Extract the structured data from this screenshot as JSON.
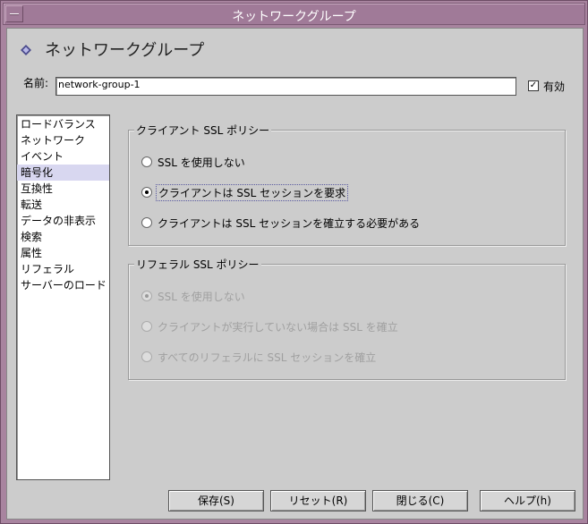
{
  "window": {
    "title": "ネットワークグループ"
  },
  "header": {
    "title": "ネットワークグループ"
  },
  "name_field": {
    "label": "名前:",
    "value": "network-group-1"
  },
  "enabled": {
    "label": "有効",
    "checked": true,
    "check_glyph": "✓"
  },
  "sidebar": {
    "items": [
      {
        "label": "ロードバランス"
      },
      {
        "label": "ネットワーク"
      },
      {
        "label": "イベント"
      },
      {
        "label": "暗号化",
        "selected": true
      },
      {
        "label": "互換性"
      },
      {
        "label": "転送"
      },
      {
        "label": "データの非表示"
      },
      {
        "label": "検索"
      },
      {
        "label": "属性"
      },
      {
        "label": "リフェラル"
      },
      {
        "label": "サーバーのロード"
      }
    ]
  },
  "client_ssl_policy": {
    "legend": "クライアント SSL ポリシー",
    "options": [
      {
        "label": "SSL を使用しない",
        "selected": false
      },
      {
        "label": "クライアントは SSL セッションを要求",
        "selected": true
      },
      {
        "label": "クライアントは SSL セッションを確立する必要がある",
        "selected": false
      }
    ]
  },
  "referral_ssl_policy": {
    "legend": "リフェラル SSL ポリシー",
    "enabled": false,
    "options": [
      {
        "label": "SSL を使用しない",
        "selected": true
      },
      {
        "label": "クライアントが実行していない場合は SSL を確立",
        "selected": false
      },
      {
        "label": "すべてのリフェラルに SSL セッションを確立",
        "selected": false
      }
    ]
  },
  "buttons": {
    "save": "保存(S)",
    "reset": "リセット(R)",
    "close": "閉じる(C)",
    "help": "ヘルプ(h)"
  },
  "colors": {
    "title_bar": "#a07a98",
    "panel_bg": "#cccccc",
    "selected_item": "#d8d7f0"
  }
}
